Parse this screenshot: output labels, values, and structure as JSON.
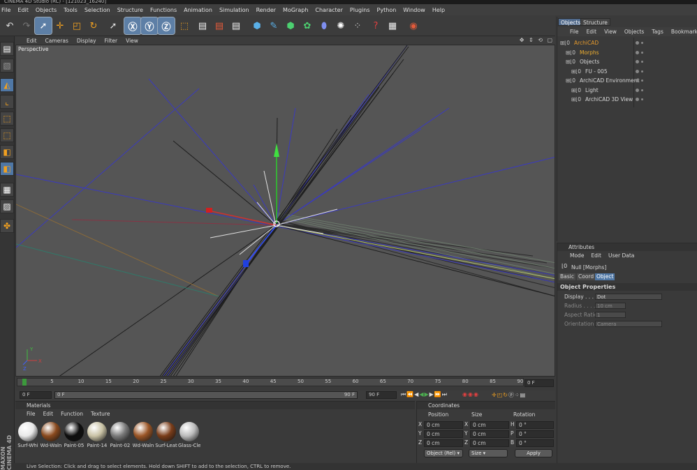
{
  "window": {
    "title": "CINEMA 4D Studio (RC) - [121023_16240]"
  },
  "menu": [
    "File",
    "Edit",
    "Objects",
    "Tools",
    "Selection",
    "Structure",
    "Functions",
    "Animation",
    "Simulation",
    "Render",
    "MoGraph",
    "Character",
    "Plugins",
    "Python",
    "Window",
    "Help"
  ],
  "toolbar_icons": [
    "undo-icon",
    "redo-icon",
    "live-selection-icon",
    "move-icon",
    "scale-icon",
    "rotate-icon",
    "recent-tool-icon",
    "x-axis-icon",
    "y-axis-icon",
    "z-axis-icon",
    "coordinate-system-icon",
    "render-view-icon",
    "render-picture-viewer-icon",
    "edit-render-settings-icon",
    "cube-icon",
    "spline-pen-icon",
    "subdivision-icon",
    "array-icon",
    "deformer-icon",
    "environment-icon",
    "mograph-icon",
    "help-icon",
    "material-manager-icon",
    "archicad-icon"
  ],
  "viewport": {
    "menu": [
      "Edit",
      "Cameras",
      "Display",
      "Filter",
      "View"
    ],
    "label": "Perspective",
    "axis": {
      "y": "Y",
      "x": "X",
      "z": "Z"
    }
  },
  "timeline": {
    "ticks": [
      "0",
      "5",
      "10",
      "15",
      "20",
      "25",
      "30",
      "35",
      "40",
      "45",
      "50",
      "55",
      "60",
      "65",
      "70",
      "75",
      "80",
      "85",
      "90"
    ],
    "current_frame": "0 F",
    "start_frame": "0 F",
    "range_start": "0 F",
    "range_end": "90 F",
    "end_frame": "90 F"
  },
  "materials": {
    "title": "Materials",
    "menu": [
      "File",
      "Edit",
      "Function",
      "Texture"
    ],
    "items": [
      {
        "name": "Surf-Whi",
        "color": "#e8e8e8"
      },
      {
        "name": "Wd-Waln",
        "color": "#8a4a1e"
      },
      {
        "name": "Paint-05",
        "color": "#0e0e0e"
      },
      {
        "name": "Paint-14",
        "color": "#c9c2a5"
      },
      {
        "name": "Paint-02",
        "color": "#7a7a7a"
      },
      {
        "name": "Wd-Waln",
        "color": "#9a5526"
      },
      {
        "name": "Surf-Leat",
        "color": "#7a3d1a"
      },
      {
        "name": "Glass-Cle",
        "color": "#bbbbbb"
      }
    ]
  },
  "coordinates": {
    "title": "Coordinates",
    "headers": [
      "Position",
      "Size",
      "Rotation"
    ],
    "rows": [
      {
        "axis": "X",
        "pos": "0 cm",
        "saxis": "X",
        "size": "0 cm",
        "raxis": "H",
        "rot": "0 °"
      },
      {
        "axis": "Y",
        "pos": "0 cm",
        "saxis": "Y",
        "size": "0 cm",
        "raxis": "P",
        "rot": "0 °"
      },
      {
        "axis": "Z",
        "pos": "0 cm",
        "saxis": "Z",
        "size": "0 cm",
        "raxis": "B",
        "rot": "0 °"
      }
    ],
    "mode": "Object (Rel)",
    "size_mode": "Size",
    "apply": "Apply"
  },
  "objects_panel": {
    "tabs": [
      "Objects",
      "Structure"
    ],
    "menu": [
      "File",
      "Edit",
      "View",
      "Objects",
      "Tags",
      "Bookmarks"
    ],
    "rows": [
      {
        "name": "ArchiCAD",
        "color": "#e69a2c",
        "indent": 0
      },
      {
        "name": "Morphs",
        "color": "#f0b030",
        "indent": 1
      },
      {
        "name": "Objects",
        "color": "#d8d8d8",
        "indent": 1
      },
      {
        "name": "FU - 005",
        "color": "#d8d8d8",
        "indent": 2
      },
      {
        "name": "ArchiCAD Environment",
        "color": "#d8d8d8",
        "indent": 1
      },
      {
        "name": "Light",
        "color": "#d8d8d8",
        "indent": 2
      },
      {
        "name": "ArchiCAD 3D View",
        "color": "#d8d8d8",
        "indent": 2
      }
    ]
  },
  "attributes": {
    "title": "Attributes",
    "menu": [
      "Mode",
      "Edit",
      "User Data"
    ],
    "object_name": "Null [Morphs]",
    "tabs": [
      "Basic",
      "Coord",
      "Object"
    ],
    "section": "Object Properties",
    "props": [
      {
        "label": "Display . . . .",
        "value": "Dot",
        "enabled": true
      },
      {
        "label": "Radius . . . .",
        "value": "10 cm",
        "enabled": false
      },
      {
        "label": "Aspect Ratio",
        "value": "1",
        "enabled": false
      },
      {
        "label": "Orientation",
        "value": "Camera",
        "enabled": false
      }
    ]
  },
  "status": "Live Selection: Click and drag to select elements. Hold down SHIFT to add to the selection, CTRL to remove.",
  "brand": {
    "line1": "MAXON",
    "line2": "CINEMA 4D"
  }
}
